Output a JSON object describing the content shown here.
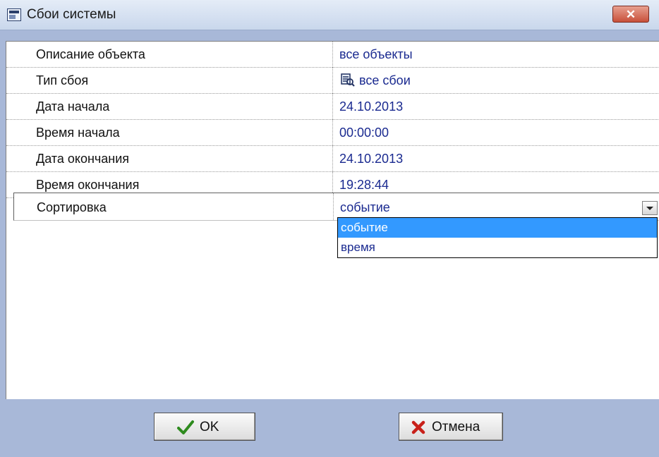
{
  "window": {
    "title": "Сбои системы",
    "close_symbol": "✕"
  },
  "rows": [
    {
      "label": "Описание объекта",
      "value": "все объекты"
    },
    {
      "label": "Тип сбоя",
      "value": "все сбои"
    },
    {
      "label": "Дата начала",
      "value": "24.10.2013"
    },
    {
      "label": "Время начала",
      "value": "00:00:00"
    },
    {
      "label": "Дата окончания",
      "value": "24.10.2013"
    },
    {
      "label": "Время окончания",
      "value": "19:28:44"
    },
    {
      "label": "Сортировка",
      "value": "событие"
    }
  ],
  "dropdown": {
    "options": [
      "событие",
      "время"
    ],
    "selected_index": 0
  },
  "buttons": {
    "ok_label": "OK",
    "cancel_label": "Отмена"
  },
  "colors": {
    "accent": "#3399ff",
    "value_text": "#1a2a90",
    "frame": "#a8b8d8"
  },
  "icons": {
    "title": "window-icon",
    "type": "list-filter-icon",
    "ok": "checkmark-icon",
    "cancel": "cross-icon"
  }
}
